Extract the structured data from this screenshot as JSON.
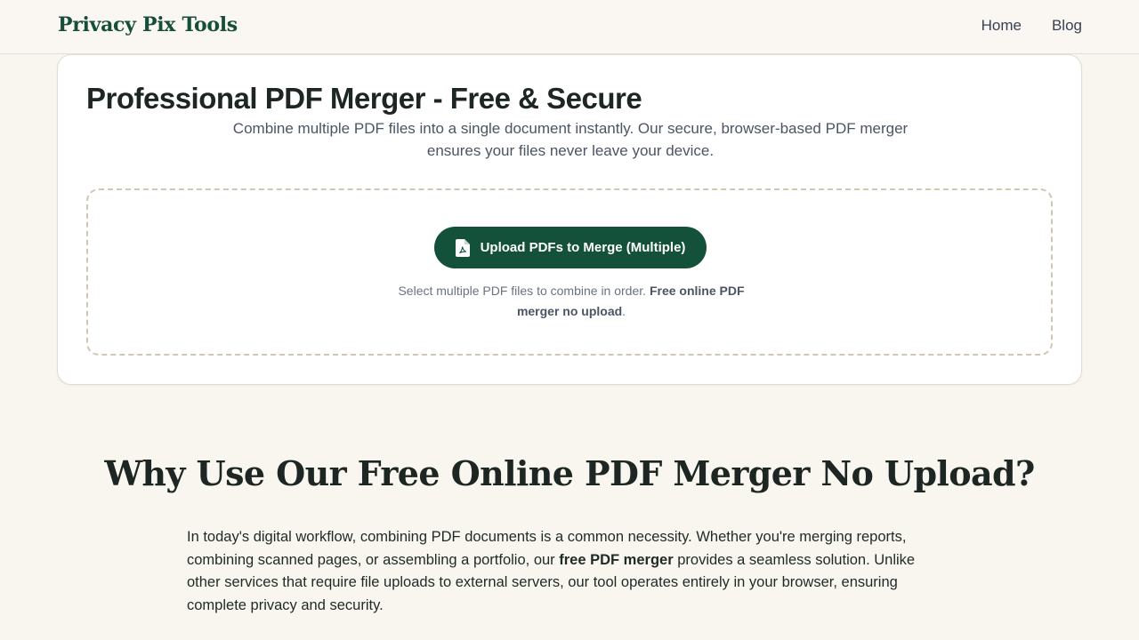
{
  "header": {
    "brand": "Privacy Pix Tools",
    "nav": [
      {
        "label": "Home"
      },
      {
        "label": "Blog"
      }
    ]
  },
  "tool": {
    "title": "Professional PDF Merger - Free & Secure",
    "intro": "Combine multiple PDF files into a single document instantly. Our secure, browser-based PDF merger ensures your files never leave your device.",
    "upload_button": "Upload PDFs to Merge (Multiple)",
    "upload_icon": "pdf-file-icon",
    "hint_text": "Select multiple PDF files to combine in order. ",
    "hint_bold": "Free online PDF merger no upload",
    "hint_end": "."
  },
  "why": {
    "title": "Why Use Our Free Online PDF Merger No Upload?",
    "body_start": "In today's digital workflow, combining PDF documents is a common necessity. Whether you're merging reports, combining scanned pages, or assembling a portfolio, our ",
    "body_bold": "free PDF merger",
    "body_end": " provides a seamless solution. Unlike other services that require file uploads to external servers, our tool operates entirely in your browser, ensuring complete privacy and security."
  },
  "colors": {
    "brand": "#164e3a",
    "button": "#14513b",
    "background": "#f9f6f0",
    "dropzone_border": "#cfc7b3"
  }
}
